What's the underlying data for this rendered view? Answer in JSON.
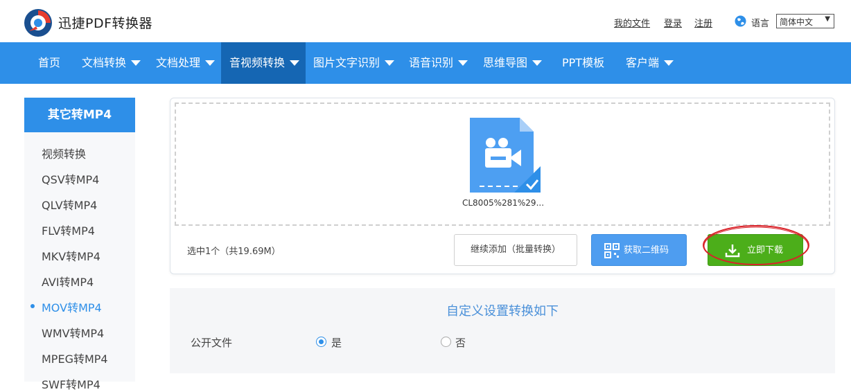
{
  "header": {
    "app_title": "迅捷PDF转换器",
    "links": [
      "我的文件",
      "登录",
      "注册"
    ],
    "lang_label": "语言",
    "lang_value": "简体中文",
    "lang_arrow": "▼"
  },
  "nav": {
    "items": [
      {
        "label": "首页",
        "dropdown": false
      },
      {
        "label": "文档转换",
        "dropdown": true
      },
      {
        "label": "文档处理",
        "dropdown": true
      },
      {
        "label": "音视频转换",
        "dropdown": true,
        "active": true
      },
      {
        "label": "图片文字识别",
        "dropdown": true
      },
      {
        "label": "语音识别",
        "dropdown": true
      },
      {
        "label": "思维导图",
        "dropdown": true
      },
      {
        "label": "PPT模板",
        "dropdown": false
      },
      {
        "label": "客户端",
        "dropdown": true
      }
    ]
  },
  "sidebar": {
    "title": "其它转MP4",
    "items": [
      {
        "label": "视频转换"
      },
      {
        "label": "QSV转MP4"
      },
      {
        "label": "QLV转MP4"
      },
      {
        "label": "FLV转MP4"
      },
      {
        "label": "MKV转MP4"
      },
      {
        "label": "AVI转MP4"
      },
      {
        "label": "MOV转MP4",
        "active": true
      },
      {
        "label": "WMV转MP4"
      },
      {
        "label": "MPEG转MP4"
      },
      {
        "label": "SWF转MP4"
      }
    ]
  },
  "upload": {
    "file_name": "CL8005%281%29...",
    "selected_info": "选中1个（共19.69M）",
    "continue_label": "继续添加（批量转换）",
    "qr_label": "获取二维码",
    "download_label": "立即下载"
  },
  "settings": {
    "title": "自定义设置转换如下",
    "public_label": "公开文件",
    "option_yes": "是",
    "option_no": "否",
    "selected": "是"
  },
  "colors": {
    "accent": "#2e8fe8",
    "nav_active": "#1566b3",
    "download_green": "#4cae1a",
    "qr_blue": "#4e9df0",
    "annotation_red": "#d9232a"
  }
}
